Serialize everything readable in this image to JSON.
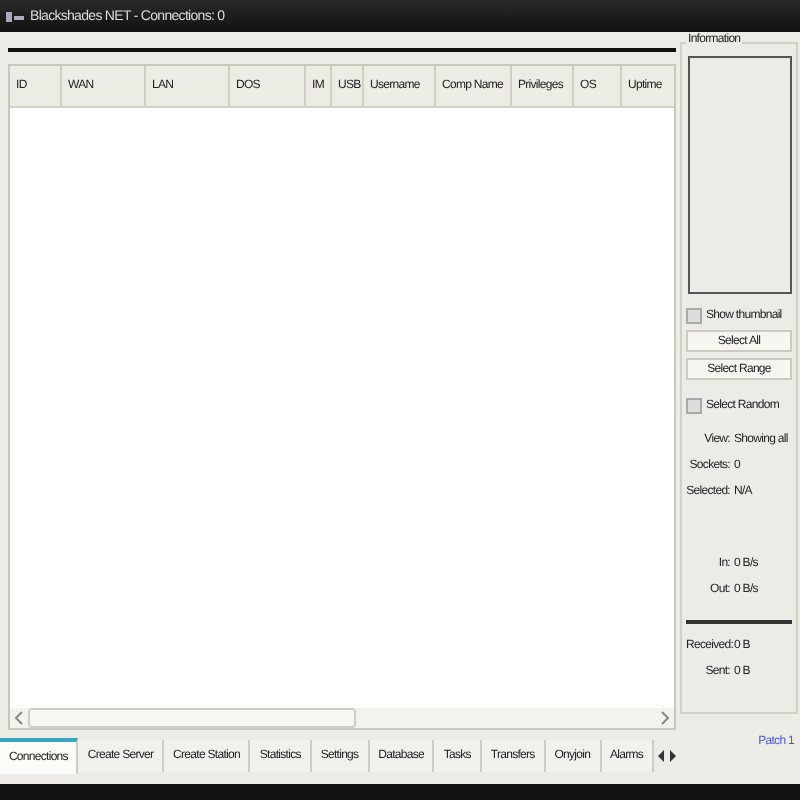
{
  "window": {
    "title": "Blackshades NET - Connections: 0"
  },
  "table": {
    "columns": [
      "ID",
      "WAN",
      "LAN",
      "DOS",
      "IM",
      "USB",
      "Username",
      "Comp Name",
      "Privileges",
      "OS",
      "Uptime"
    ]
  },
  "information": {
    "title": "Information",
    "show_thumbnail": {
      "label": "Show thumbnail",
      "checked": false
    },
    "buttons": [
      "Select All",
      "Select Range"
    ],
    "select_random": {
      "label": "Select Random",
      "checked": false
    },
    "stats": [
      {
        "label": "View:",
        "value": "Showing all"
      },
      {
        "label": "Sockets:",
        "value": "0"
      },
      {
        "label": "Selected:",
        "value": "N/A"
      }
    ],
    "rates": [
      {
        "label": "In:",
        "value": "0 B/s"
      },
      {
        "label": "Out:",
        "value": "0 B/s"
      }
    ],
    "totals": [
      {
        "label": "Received:",
        "value": "0 B"
      },
      {
        "label": "Sent:",
        "value": "0 B"
      }
    ]
  },
  "tabs": [
    {
      "label": "Connections",
      "selected": true
    },
    {
      "label": "Create Server",
      "selected": false
    },
    {
      "label": "Create Station",
      "selected": false
    },
    {
      "label": "Statistics",
      "selected": false
    },
    {
      "label": "Settings",
      "selected": false
    },
    {
      "label": "Database",
      "selected": false
    },
    {
      "label": "Tasks",
      "selected": false
    },
    {
      "label": "Transfers",
      "selected": false
    },
    {
      "label": "Onyjoin",
      "selected": false
    },
    {
      "label": "Alarms",
      "selected": false
    }
  ],
  "patch_link": "Patch 1"
}
